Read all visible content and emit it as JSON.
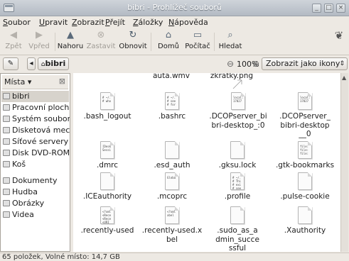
{
  "window": {
    "title": "bibri - Prohlížeč souborů"
  },
  "menu": [
    "Soubor",
    "Upravit",
    "Zobrazit",
    "Přejít",
    "Záložky",
    "Nápověda"
  ],
  "toolbar": {
    "back": "Zpět",
    "forward": "Vpřed",
    "up": "Nahoru",
    "stop": "Zastavit",
    "reload": "Obnovit",
    "home": "Domů",
    "computer": "Počítač",
    "search": "Hledat"
  },
  "location": {
    "path_button": "bibri",
    "zoom": "100%",
    "view_mode": "Zobrazit jako ikony"
  },
  "sidebar": {
    "header": "Místa",
    "items": [
      "bibri",
      "Pracovní plocha",
      "Systém souborů",
      "Disketová mechanika",
      "Síťové servery",
      "Disk DVD-ROM",
      "Koš",
      "Dokumenty",
      "Hudba",
      "Obrázky",
      "Videa"
    ]
  },
  "files": [
    {
      "name": "auta.wmv",
      "preview": ""
    },
    {
      "name": "zkratky.png",
      "preview": ""
    },
    {
      "name": ".bash_logout",
      "preview": "# ~/.\n# who"
    },
    {
      "name": ".bashrc",
      "preview": "# ~/.\n# see\n# for"
    },
    {
      "name": ".DCOPserver_bibri-desktop_:0",
      "preview": "local:\n17827"
    },
    {
      "name": ".DCOPserver_bibri-desktop__0",
      "preview": "local:\n17827"
    },
    {
      "name": ".dmrc",
      "preview": "[Desk\nSessi"
    },
    {
      "name": ".esd_auth",
      "preview": ""
    },
    {
      "name": ".gksu.lock",
      "preview": ""
    },
    {
      "name": ".gtk-bookmarks",
      "preview": "file:\nfile:\nfile:"
    },
    {
      "name": ".ICEauthority",
      "preview": ""
    },
    {
      "name": ".mcoprc",
      "preview": "Globa"
    },
    {
      "name": ".profile",
      "preview": "# ~/.\n# Thi\n# exi\n# see"
    },
    {
      "name": ".pulse-cookie",
      "preview": ""
    },
    {
      "name": ".recently-used",
      "preview": "<?xml\n<Rece\n<Rece\n<URI"
    },
    {
      "name": ".recently-used.xbel",
      "preview": "<?xml\nxbel"
    },
    {
      "name": ".sudo_as_admin_successful",
      "preview": ""
    },
    {
      "name": ".Xauthority",
      "preview": ""
    }
  ],
  "status": "65 položek, Volné místo: 14,7 GB"
}
